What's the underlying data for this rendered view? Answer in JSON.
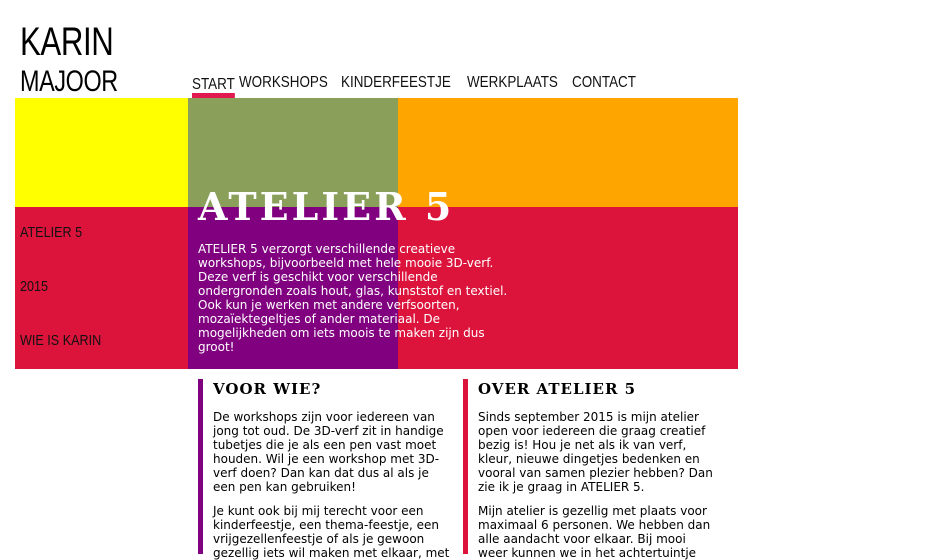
{
  "brand": {
    "line1": "KARIN",
    "line2": "MAJOOR"
  },
  "nav": {
    "items": [
      {
        "label": "START",
        "active": true
      },
      {
        "label": "WORKSHOPS"
      },
      {
        "label": "KINDERFEESTJE"
      },
      {
        "label": "WERKPLAATS"
      },
      {
        "label": "CONTACT"
      }
    ]
  },
  "colors": {
    "yellow": "#ffff00",
    "green": "#8aa05a",
    "orange": "#ffa500",
    "red": "#dc143c",
    "purple": "#800080",
    "nav_active": "#e01a4f"
  },
  "sidebar": {
    "items": [
      {
        "label": "ATELIER 5"
      },
      {
        "label": "2015"
      },
      {
        "label": "WIE IS KARIN"
      }
    ]
  },
  "hero": {
    "title": "ATELIER 5",
    "text": "ATELIER 5 verzorgt verschillende creatieve workshops, bijvoorbeeld met hele mooie 3D-verf. Deze verf is geschikt voor verschillende ondergronden zoals hout, glas, kunststof en textiel. Ook kun je werken met andere verfsoorten, mozaïektegeltjes of ander materiaal. De mogelijkheden om iets moois te maken zijn dus groot!"
  },
  "columns": [
    {
      "title": "VOOR WIE?",
      "paragraphs": [
        "De workshops zijn voor iedereen van jong tot oud. De 3D-verf zit in handige tubetjes die je als een pen vast moet houden. Wil je een workshop met 3D-verf doen? Dan kan dat dus al als je een pen kan gebruiken!",
        "Je kunt ook bij mij terecht voor een kinderfeestje, een thema-feestje, een vrijgezellenfeestje of als je gewoon gezellig iets wil maken met elkaar, met"
      ]
    },
    {
      "title": "OVER ATELIER 5",
      "paragraphs": [
        "Sinds september 2015 is mijn atelier open voor iedereen die graag creatief bezig is! Hou je net als ik van verf, kleur, nieuwe dingetjes bedenken en vooral van samen plezier hebben? Dan zie ik je graag in ATELIER 5.",
        "Mijn atelier is gezellig met plaats voor maximaal 6 personen. We hebben dan alle aandacht voor elkaar. Bij mooi weer kunnen we in het achtertuintje"
      ]
    }
  ]
}
